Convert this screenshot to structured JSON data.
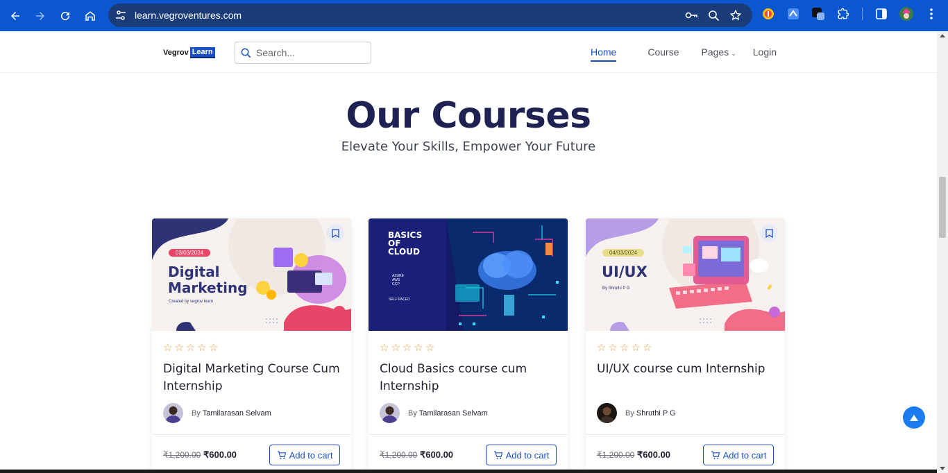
{
  "browser": {
    "url": "learn.vegroventures.com"
  },
  "header": {
    "logo_word": "Vegrov",
    "logo_badge": "Learn",
    "search_placeholder": "Search...",
    "nav": [
      "Home",
      "Course",
      "Pages",
      "Login"
    ]
  },
  "hero": {
    "title": "Our Courses",
    "subtitle": "Elevate Your Skills, Empower Your Future"
  },
  "courses": [
    {
      "title": "Digital Marketing Course Cum Internship",
      "author_prefix": "By",
      "author": "Tamilarasan Selvam",
      "old_price": "₹1,200.00",
      "price": "₹600.00",
      "cart_label": "Add to cart",
      "rating": 0,
      "thumb": {
        "date": "03/03/2024",
        "line1": "Digital",
        "line2": "Marketing",
        "note": "Created by vegrov learn"
      }
    },
    {
      "title": "Cloud Basics course cum Internship",
      "author_prefix": "By",
      "author": "Tamilarasan Selvam",
      "old_price": "₹1,200.00",
      "price": "₹600.00",
      "cart_label": "Add to cart",
      "rating": 0,
      "thumb": {
        "line1": "BASICS",
        "line2": "OF",
        "line3": "CLOUD",
        "items": [
          "AZURE",
          "AWS",
          "GCP"
        ],
        "note": "SELF PACED"
      }
    },
    {
      "title": "UI/UX course cum Internship",
      "author_prefix": "By",
      "author": "Shruthi P G",
      "old_price": "₹1,200.00",
      "price": "₹600.00",
      "cart_label": "Add to cart",
      "rating": 0,
      "thumb": {
        "date": "04/03/2024",
        "line1": "UI/UX",
        "note": "By Shruthi P G"
      }
    }
  ],
  "colors": {
    "browser_blue": "#0b57d0",
    "brand_blue": "#1b4fc4",
    "title_navy": "#1f2153",
    "star_orange": "#e8a045"
  }
}
